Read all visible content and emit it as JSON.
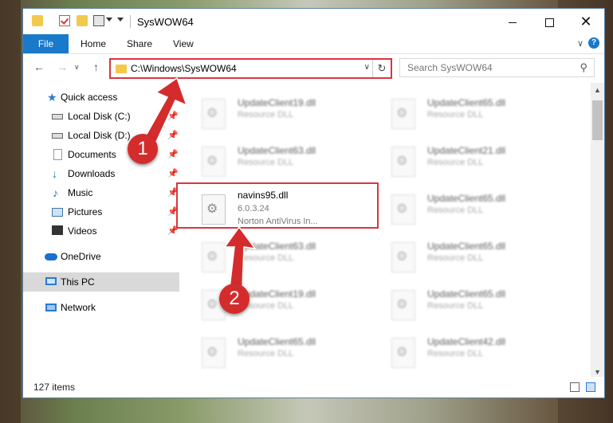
{
  "window": {
    "title": "SysWOW64",
    "controls": {
      "minimize": "",
      "maximize": "",
      "close": "✕"
    }
  },
  "ribbon": {
    "tabs": [
      "File",
      "Home",
      "Share",
      "View"
    ],
    "help": "?"
  },
  "navigation": {
    "back": "←",
    "forward": "→",
    "up": "↑",
    "address": "C:\\Windows\\SysWOW64",
    "refresh": "↻",
    "search_placeholder": "Search SysWOW64"
  },
  "sidebar": {
    "items": [
      {
        "label": "Quick access",
        "icon": "star-icon"
      },
      {
        "label": "Local Disk (C:)",
        "icon": "disk-icon"
      },
      {
        "label": "Local Disk (D:)",
        "icon": "disk-icon"
      },
      {
        "label": "Documents",
        "icon": "documents-icon"
      },
      {
        "label": "Downloads",
        "icon": "downloads-icon"
      },
      {
        "label": "Music",
        "icon": "music-icon"
      },
      {
        "label": "Pictures",
        "icon": "pictures-icon"
      },
      {
        "label": "Videos",
        "icon": "videos-icon"
      },
      {
        "label": "OneDrive",
        "icon": "onedrive-icon"
      },
      {
        "label": "This PC",
        "icon": "computer-icon"
      },
      {
        "label": "Network",
        "icon": "network-icon"
      }
    ]
  },
  "files": [
    {
      "name": "UpdateClient19.dll",
      "desc": "Resource DLL"
    },
    {
      "name": "UpdateClient65.dll",
      "desc": "Resource DLL"
    },
    {
      "name": "UpdateClient63.dll",
      "desc": "Resource DLL"
    },
    {
      "name": "UpdateClient21.dll",
      "desc": "Resource DLL"
    },
    {
      "name": "navins95.dll",
      "version": "6.0.3.24",
      "desc": "Norton AntiVirus In..."
    },
    {
      "name": "UpdateClient65.dll",
      "desc": "Resource DLL"
    },
    {
      "name": "UpdateClient63.dll",
      "desc": "Resource DLL"
    },
    {
      "name": "UpdateClient65.dll",
      "desc": "Resource DLL"
    },
    {
      "name": "UpdateClient19.dll",
      "desc": "Resource DLL"
    },
    {
      "name": "UpdateClient65.dll",
      "desc": "Resource DLL"
    },
    {
      "name": "UpdateClient65.dll",
      "desc": "Resource DLL"
    },
    {
      "name": "UpdateClient42.dll",
      "desc": "Resource DLL"
    }
  ],
  "status": {
    "item_count": "127 items"
  },
  "annotations": {
    "step1": "1",
    "step2": "2",
    "color": "#d42c2c"
  }
}
